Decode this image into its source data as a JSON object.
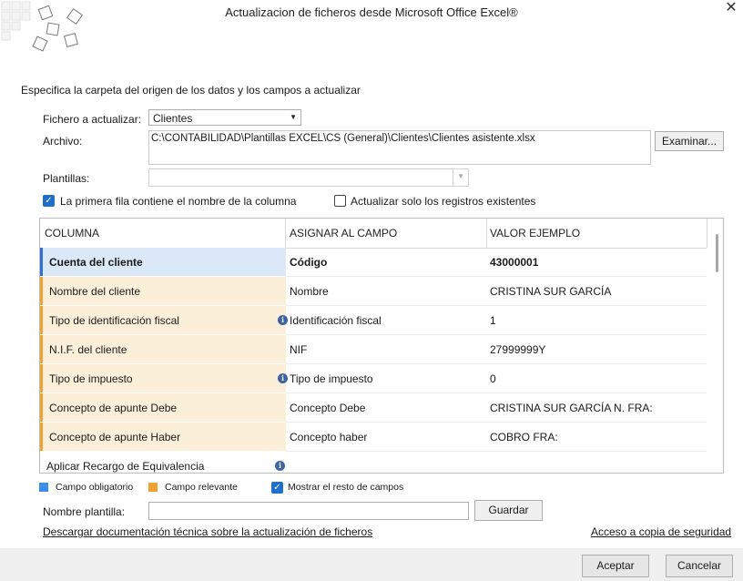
{
  "window": {
    "title": "Actualizacion de ficheros desde Microsoft Office Excel®",
    "close_glyph": "✕"
  },
  "subtitle": "Especifica la carpeta del origen de los datos y los campos a actualizar",
  "form": {
    "fichero_label": "Fichero a actualizar:",
    "fichero_value": "Clientes",
    "archivo_label": "Archivo:",
    "archivo_value": "C:\\CONTABILIDAD\\Plantillas EXCEL\\CS (General)\\Clientes\\Clientes asistente.xlsx",
    "examinar_label": "Examinar...",
    "plantillas_label": "Plantillas:",
    "plantillas_value": ""
  },
  "options": {
    "primera_fila_label": "La primera fila contiene el nombre de la columna",
    "primera_fila_checked": true,
    "solo_existentes_label": "Actualizar solo los registros existentes",
    "solo_existentes_checked": false
  },
  "grid": {
    "headers": [
      "COLUMNA",
      "ASIGNAR AL CAMPO",
      "VALOR EJEMPLO"
    ],
    "rows": [
      {
        "columna": "Cuenta del cliente",
        "campo": "Código",
        "valor": "43000001",
        "kind": "obligatorio",
        "info": false
      },
      {
        "columna": "Nombre del cliente",
        "campo": "Nombre",
        "valor": "CRISTINA SUR GARCÍA",
        "kind": "relevante",
        "info": false
      },
      {
        "columna": "Tipo de identificación fiscal",
        "campo": "Identificación fiscal",
        "valor": "1",
        "kind": "relevante",
        "info": true
      },
      {
        "columna": "N.I.F. del cliente",
        "campo": "NIF",
        "valor": "27999999Y",
        "kind": "relevante",
        "info": false
      },
      {
        "columna": "Tipo de impuesto",
        "campo": "Tipo de impuesto",
        "valor": "0",
        "kind": "relevante",
        "info": true
      },
      {
        "columna": "Concepto de apunte Debe",
        "campo": "Concepto Debe",
        "valor": "CRISTINA SUR GARCÍA N. FRA:",
        "kind": "relevante",
        "info": false
      },
      {
        "columna": "Concepto de apunte Haber",
        "campo": "Concepto haber",
        "valor": "COBRO FRA:",
        "kind": "relevante",
        "info": false
      },
      {
        "columna": "Aplicar Recargo de Equivalencia",
        "campo": "",
        "valor": "",
        "kind": "normal",
        "info": true
      }
    ]
  },
  "legend": {
    "obligatorio_label": "Campo obligatorio",
    "obligatorio_color": "#3d8ee8",
    "relevante_label": "Campo relevante",
    "relevante_color": "#f0a131",
    "mostrar_label": "Mostrar el resto de campos",
    "mostrar_checked": true
  },
  "plantilla": {
    "label": "Nombre plantilla:",
    "value": "",
    "guardar_label": "Guardar"
  },
  "links": {
    "documentacion": "Descargar documentación técnica sobre la actualización de ficheros",
    "copia": "Acceso a copia de seguridad"
  },
  "footer": {
    "aceptar": "Aceptar",
    "cancelar": "Cancelar"
  }
}
